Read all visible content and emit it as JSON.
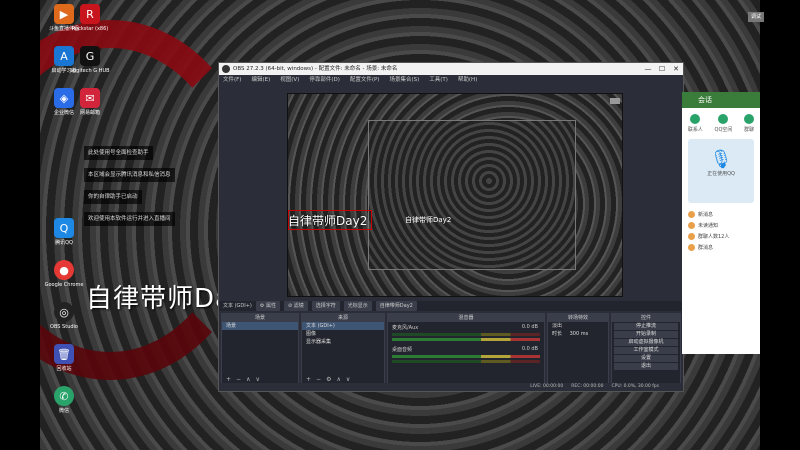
{
  "desktop": {
    "icons": [
      {
        "label": "斗鱼直播伴侣",
        "color": "#e06a1b",
        "glyph": "▶"
      },
      {
        "label": "Rockstar\n(x86)",
        "color": "#c8141c",
        "glyph": "R"
      },
      {
        "label": "启动学习者",
        "color": "#1976d2",
        "glyph": "A"
      },
      {
        "label": "Logitech G\nHUB",
        "color": "#111",
        "glyph": "G"
      },
      {
        "label": "企业微信",
        "color": "#2a6be8",
        "glyph": "◈"
      },
      {
        "label": "网易邮箱",
        "color": "#d2243a",
        "glyph": "✉"
      },
      {
        "label": "腾讯QQ",
        "color": "#1e88e5",
        "glyph": "Q"
      },
      {
        "label": "Google Chrome",
        "color": "#e53935",
        "glyph": "●"
      },
      {
        "label": "OBS Studio",
        "color": "#222",
        "glyph": "◎"
      },
      {
        "label": "回收站",
        "color": "#3f51b5",
        "glyph": "🗑"
      },
      {
        "label": "微信",
        "color": "#2aa36b",
        "glyph": "✆"
      }
    ],
    "notices": [
      "此处使用号全面检查助手",
      "本区域会显示腾讯消息和私信消息",
      "你的自律助手已启动",
      "欢迎使用本软件运行并进入直播间"
    ],
    "big_caption": "自律带师Day2",
    "right_badge": "调试"
  },
  "obs": {
    "title": "OBS 27.2.3 (64-bit, windows) - 配置文件: 未命名 - 场景: 未命名",
    "window_controls": [
      "—",
      "☐",
      "✕"
    ],
    "menu": [
      "文件(F)",
      "编辑(E)",
      "视图(V)",
      "停靠部件(D)",
      "配置文件(P)",
      "场景集合(S)",
      "工具(T)",
      "帮助(H)"
    ],
    "preview_caption": "自律带师Day2",
    "mini_caption": "自律带师Day2",
    "toolbar": [
      "文本 (GDI+)",
      "⚙ 属性",
      "⊘ 滤镜",
      "选择字符",
      "光标显示",
      "自律带师Day2"
    ],
    "scenes": {
      "title": "场景",
      "items": [
        "场景"
      ],
      "footer": [
        "+",
        "−",
        "∧",
        "∨"
      ]
    },
    "sources": {
      "title": "来源",
      "items": [
        "文本 (GDI+)",
        "图像",
        "显示器采集"
      ],
      "footer": [
        "+",
        "−",
        "⚙",
        "∧",
        "∨"
      ]
    },
    "mixer": {
      "title": "混音器",
      "tracks": [
        {
          "name": "麦克风/Aux",
          "db": "0.0 dB"
        },
        {
          "name": "桌面音频",
          "db": "0.0 dB"
        }
      ]
    },
    "transitions": {
      "title": "转场特效",
      "type": "淡出",
      "duration_label": "时长",
      "duration": "300 ms"
    },
    "controls": {
      "title": "控件",
      "buttons": [
        "停止推流",
        "开始录制",
        "启动虚拟摄像机",
        "工作室模式",
        "设置",
        "退出"
      ]
    },
    "status": [
      "LIVE: 00:00:00",
      "REC: 00:00:00",
      "CPU: 0.0%, 30.00 fps"
    ]
  },
  "qq": {
    "header": "会话",
    "tabs": [
      "联系人",
      "QQ空间",
      "群聊"
    ],
    "card_label": "正在使用QQ",
    "items": [
      "新消息",
      "未读通知",
      "群聊人数12人",
      "群消息"
    ]
  }
}
